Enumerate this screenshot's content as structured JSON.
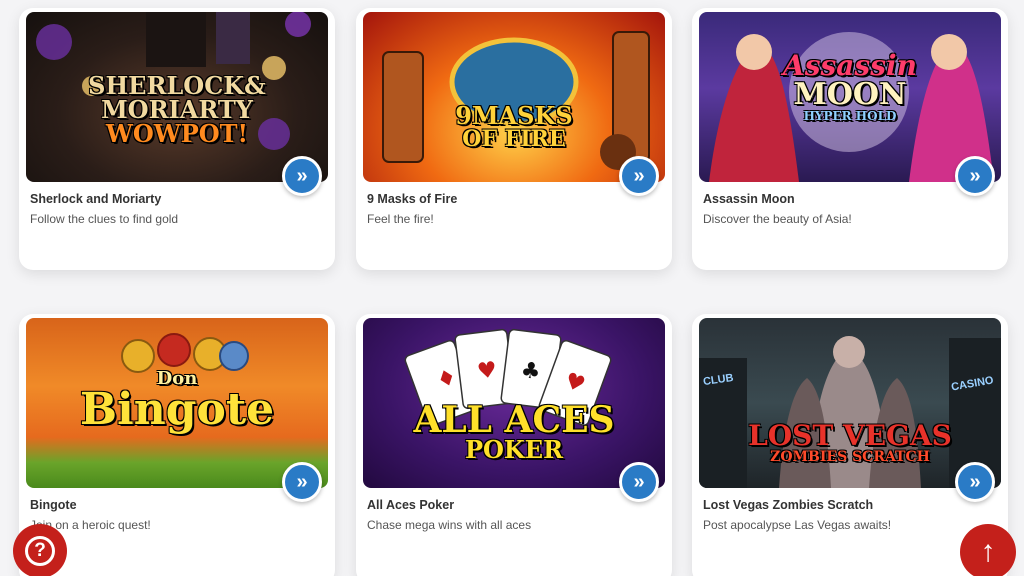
{
  "games": [
    {
      "title": "Sherlock and Moriarty",
      "desc": "Follow the clues to find gold",
      "logo_line1": "SHERLOCK&",
      "logo_line2": "MORIARTY",
      "logo_line3": "WOWPOT!"
    },
    {
      "title": "9 Masks of Fire",
      "desc": "Feel the fire!",
      "logo_line1": "9MASKS",
      "logo_line2": "OF FIRE"
    },
    {
      "title": "Assassin Moon",
      "desc": "Discover the beauty of Asia!",
      "logo_line1": "Assassin",
      "logo_line2": "MOON",
      "logo_line3": "HYPER HOLD"
    },
    {
      "title": "Bingote",
      "desc": "Join on a heroic quest!",
      "logo_line1": "Don",
      "logo_line2": "Bingote"
    },
    {
      "title": "All Aces Poker",
      "desc": "Chase mega wins with all aces",
      "logo_line1": "ALL ACES",
      "logo_line2": "POKER"
    },
    {
      "title": "Lost Vegas Zombies Scratch",
      "desc": "Post apocalypse Las Vegas awaits!",
      "logo_line1": "LOST VEGAS",
      "logo_line2": "ZOMBIES SCRATCH",
      "sign1": "CLUB",
      "sign2": "CASINO"
    }
  ],
  "icons": {
    "play": "play-arrow-icon",
    "help": "question-mark-icon",
    "scroll_top": "arrow-up-icon"
  },
  "colors": {
    "play_button": "#2a7bc6",
    "action_button": "#c4201b"
  }
}
